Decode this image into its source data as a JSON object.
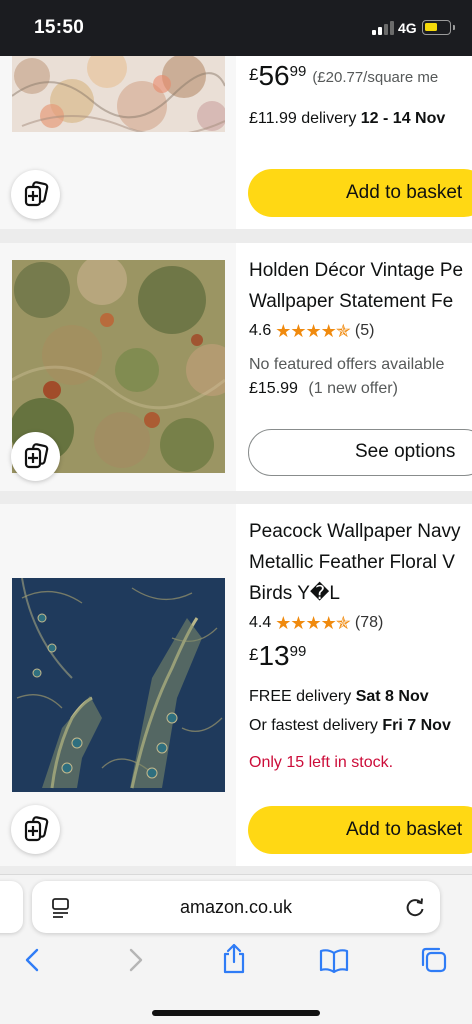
{
  "status_bar": {
    "time": "15:50",
    "network": "4G",
    "battery_level": 0.4
  },
  "colors": {
    "accent_yellow": "#ffd814",
    "star_orange": "#f08a0e",
    "stock_red": "#cc0c39",
    "ios_blue": "#2f7cf6"
  },
  "products": [
    {
      "price": {
        "currency": "£",
        "whole": "56",
        "fraction": "99",
        "unit_price": "(£20.77/square me"
      },
      "delivery_prefix": "£11.99 delivery ",
      "delivery_date": "12 - 14 Nov",
      "button": "Add to basket",
      "compare_icon": "compare-add-icon"
    },
    {
      "title_lines": [
        "Holden Décor Vintage Pe",
        "Wallpaper Statement Fe"
      ],
      "rating": "4.6",
      "stars": "★★★★✯",
      "review_count": "(5)",
      "offers_note": "No featured offers available",
      "offer_price": "£15.99",
      "offer_count": "(1 new offer)",
      "button": "See options",
      "compare_icon": "compare-add-icon"
    },
    {
      "title_lines": [
        "Peacock Wallpaper Navy",
        "Metallic Feather Floral V",
        "Birds Y�L"
      ],
      "rating": "4.4",
      "stars": "★★★★✯",
      "review_count": "(78)",
      "price": {
        "currency": "£",
        "whole": "13",
        "fraction": "99"
      },
      "delivery_1_prefix": "FREE delivery ",
      "delivery_1_date": "Sat 8 Nov",
      "delivery_2_prefix": "Or fastest delivery ",
      "delivery_2_date": "Fri 7 Nov",
      "stock": "Only 15 left in stock.",
      "button": "Add to basket",
      "compare_icon": "compare-add-icon"
    }
  ],
  "browser": {
    "url": "amazon.co.uk",
    "icons": [
      "reader-mode-icon",
      "reload-icon",
      "back-icon",
      "forward-icon",
      "share-icon",
      "bookmarks-icon",
      "tabs-icon"
    ]
  }
}
